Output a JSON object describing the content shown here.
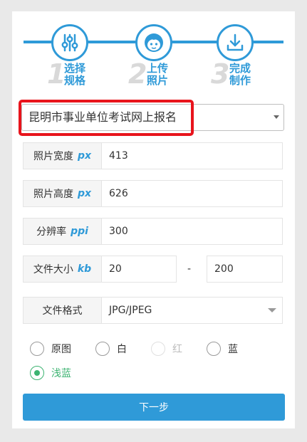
{
  "steps": [
    {
      "num": "1",
      "line1": "选择",
      "line2": "规格",
      "icon": "sliders-icon"
    },
    {
      "num": "2",
      "line1": "上传",
      "line2": "照片",
      "icon": "face-icon"
    },
    {
      "num": "3",
      "line1": "完成",
      "line2": "制作",
      "icon": "download-icon"
    }
  ],
  "preset": {
    "value": "昆明市事业单位考试网上报名"
  },
  "fields": {
    "width": {
      "label": "照片宽度",
      "unit": "px",
      "value": "413"
    },
    "height": {
      "label": "照片高度",
      "unit": "px",
      "value": "626"
    },
    "dpi": {
      "label": "分辨率",
      "unit": "ppi",
      "value": "300"
    },
    "size": {
      "label": "文件大小",
      "unit": "kb",
      "min": "20",
      "sep": "-",
      "max": "200"
    },
    "format": {
      "label": "文件格式",
      "value": "JPG/JPEG"
    }
  },
  "background": {
    "options": [
      "原图",
      "白",
      "红",
      "蓝",
      "浅蓝"
    ],
    "selected": "浅蓝",
    "disabled": "红"
  },
  "next_label": "下一步",
  "colors": {
    "accent": "#2f9ad8",
    "highlight": "#e8141c",
    "selected": "#3cb371"
  }
}
